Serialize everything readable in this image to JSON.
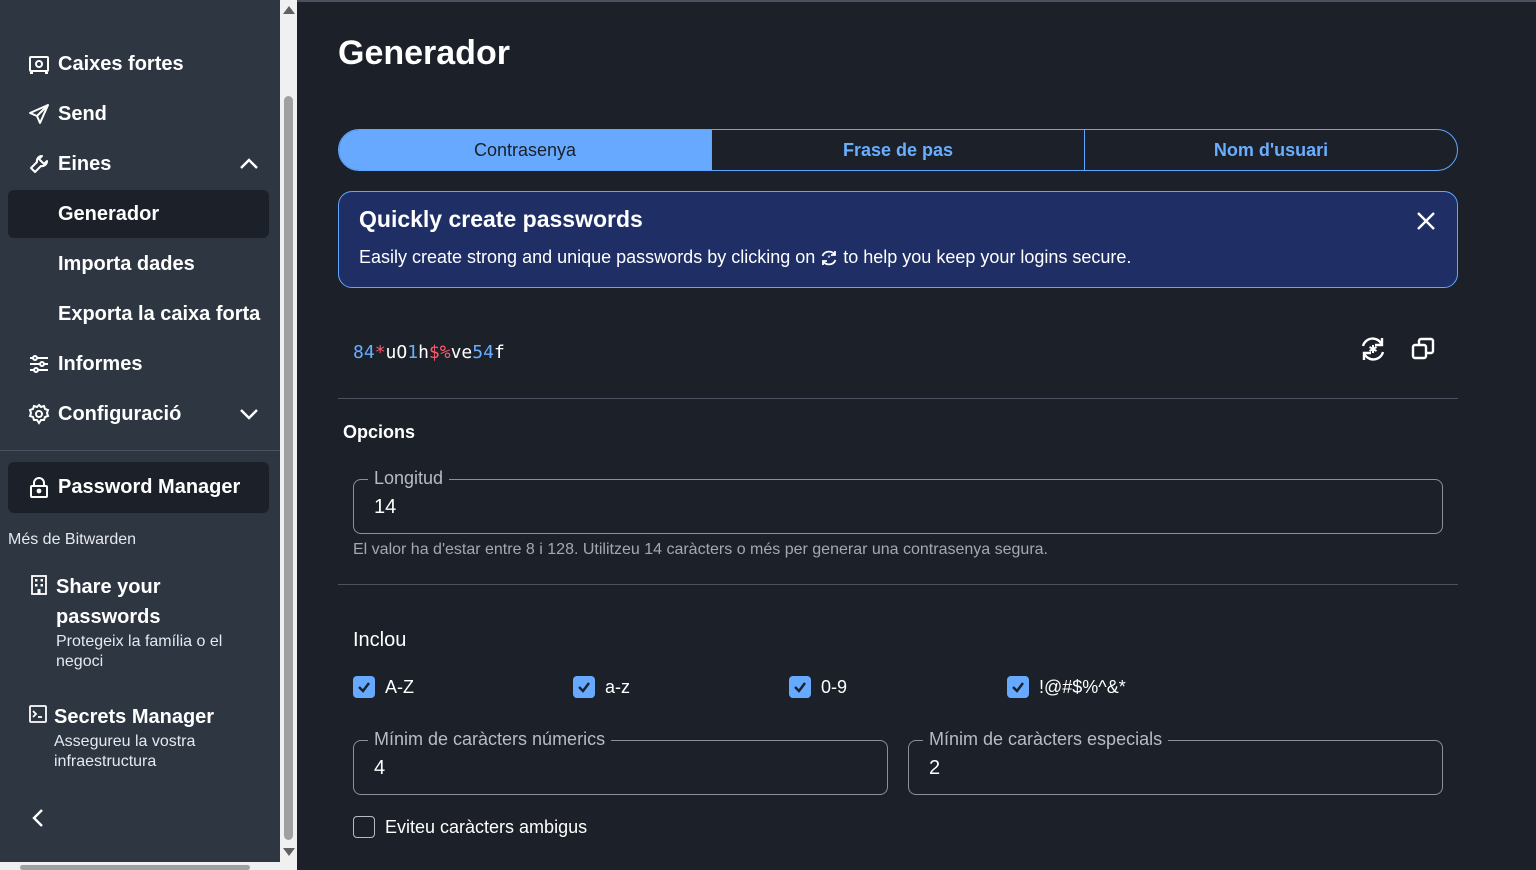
{
  "sidebar": {
    "items": [
      {
        "label": "Caixes fortes",
        "icon": "vault-icon"
      },
      {
        "label": "Send",
        "icon": "send-icon"
      },
      {
        "label": "Eines",
        "icon": "wrench-icon"
      },
      {
        "label": "Generador"
      },
      {
        "label": "Importa dades"
      },
      {
        "label": "Exporta la caixa forta"
      },
      {
        "label": "Informes",
        "icon": "sliders-icon"
      },
      {
        "label": "Configuració",
        "icon": "gear-icon"
      }
    ],
    "product_button": "Password Manager",
    "more_label": "Més de Bitwarden",
    "products": [
      {
        "title": "Share your passwords",
        "desc": "Protegeix la família o el negoci"
      },
      {
        "title": "Secrets Manager",
        "desc": "Assegureu la vostra infraestructura"
      }
    ]
  },
  "main": {
    "title": "Generador",
    "tabs": [
      {
        "label": "Contrasenya",
        "active": true
      },
      {
        "label": "Frase de pas",
        "active": false
      },
      {
        "label": "Nom d'usuari",
        "active": false
      }
    ],
    "callout": {
      "title": "Quickly create passwords",
      "body_before": "Easily create strong and unique passwords by clicking on",
      "body_after": "to help you keep your logins secure."
    },
    "password": {
      "parts": [
        {
          "text": "84",
          "kind": "num"
        },
        {
          "text": "*",
          "kind": "spec"
        },
        {
          "text": "uO",
          "kind": "letter"
        },
        {
          "text": "1",
          "kind": "num"
        },
        {
          "text": "h",
          "kind": "letter"
        },
        {
          "text": "$%",
          "kind": "spec"
        },
        {
          "text": "ve",
          "kind": "letter"
        },
        {
          "text": "54",
          "kind": "num"
        },
        {
          "text": "f",
          "kind": "letter"
        }
      ]
    },
    "options_label": "Opcions",
    "length": {
      "label": "Longitud",
      "value": "14"
    },
    "length_hint": "El valor ha d'estar entre 8 i 128. Utilitzeu 14 caràcters o més per generar una contrasenya segura.",
    "include_label": "Inclou",
    "include": [
      {
        "label": "A-Z",
        "checked": true
      },
      {
        "label": "a-z",
        "checked": true
      },
      {
        "label": "0-9",
        "checked": true
      },
      {
        "label": "!@#$%^&*",
        "checked": true
      }
    ],
    "min_numbers": {
      "label": "Mínim de caràcters númerics",
      "value": "4"
    },
    "min_special": {
      "label": "Mínim de caràcters especials",
      "value": "2"
    },
    "avoid_ambiguous": {
      "label": "Eviteu caràcters ambigus",
      "checked": false
    }
  },
  "colors": {
    "accent": "#66a9ff",
    "special_char": "#ff5b6b",
    "callout_bg": "#1f2f66",
    "sidebar_bg": "#2e3642",
    "main_bg": "#1b2029"
  }
}
